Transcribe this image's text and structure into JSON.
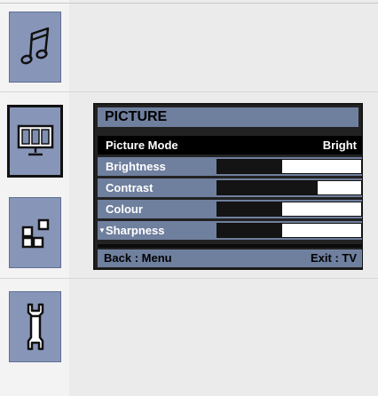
{
  "sidebar": {
    "icons": [
      {
        "name": "music-icon"
      },
      {
        "name": "picture-icon",
        "active": true
      },
      {
        "name": "setup-icon"
      },
      {
        "name": "wrench-icon"
      }
    ]
  },
  "menu": {
    "title": "PICTURE",
    "items": [
      {
        "label": "Picture Mode",
        "value": "Bright",
        "selected": true
      },
      {
        "label": "Brightness",
        "level": 0.45
      },
      {
        "label": "Contrast",
        "level": 0.7
      },
      {
        "label": "Colour",
        "level": 0.45
      },
      {
        "label": "Sharpness",
        "level": 0.45,
        "scroll_marker": "▼"
      }
    ],
    "footer": {
      "left": "Back : Menu",
      "right": "Exit : TV"
    }
  },
  "colors": {
    "panel": "#6f7f9e",
    "icon": "#8796b8",
    "selected": "#000000"
  }
}
